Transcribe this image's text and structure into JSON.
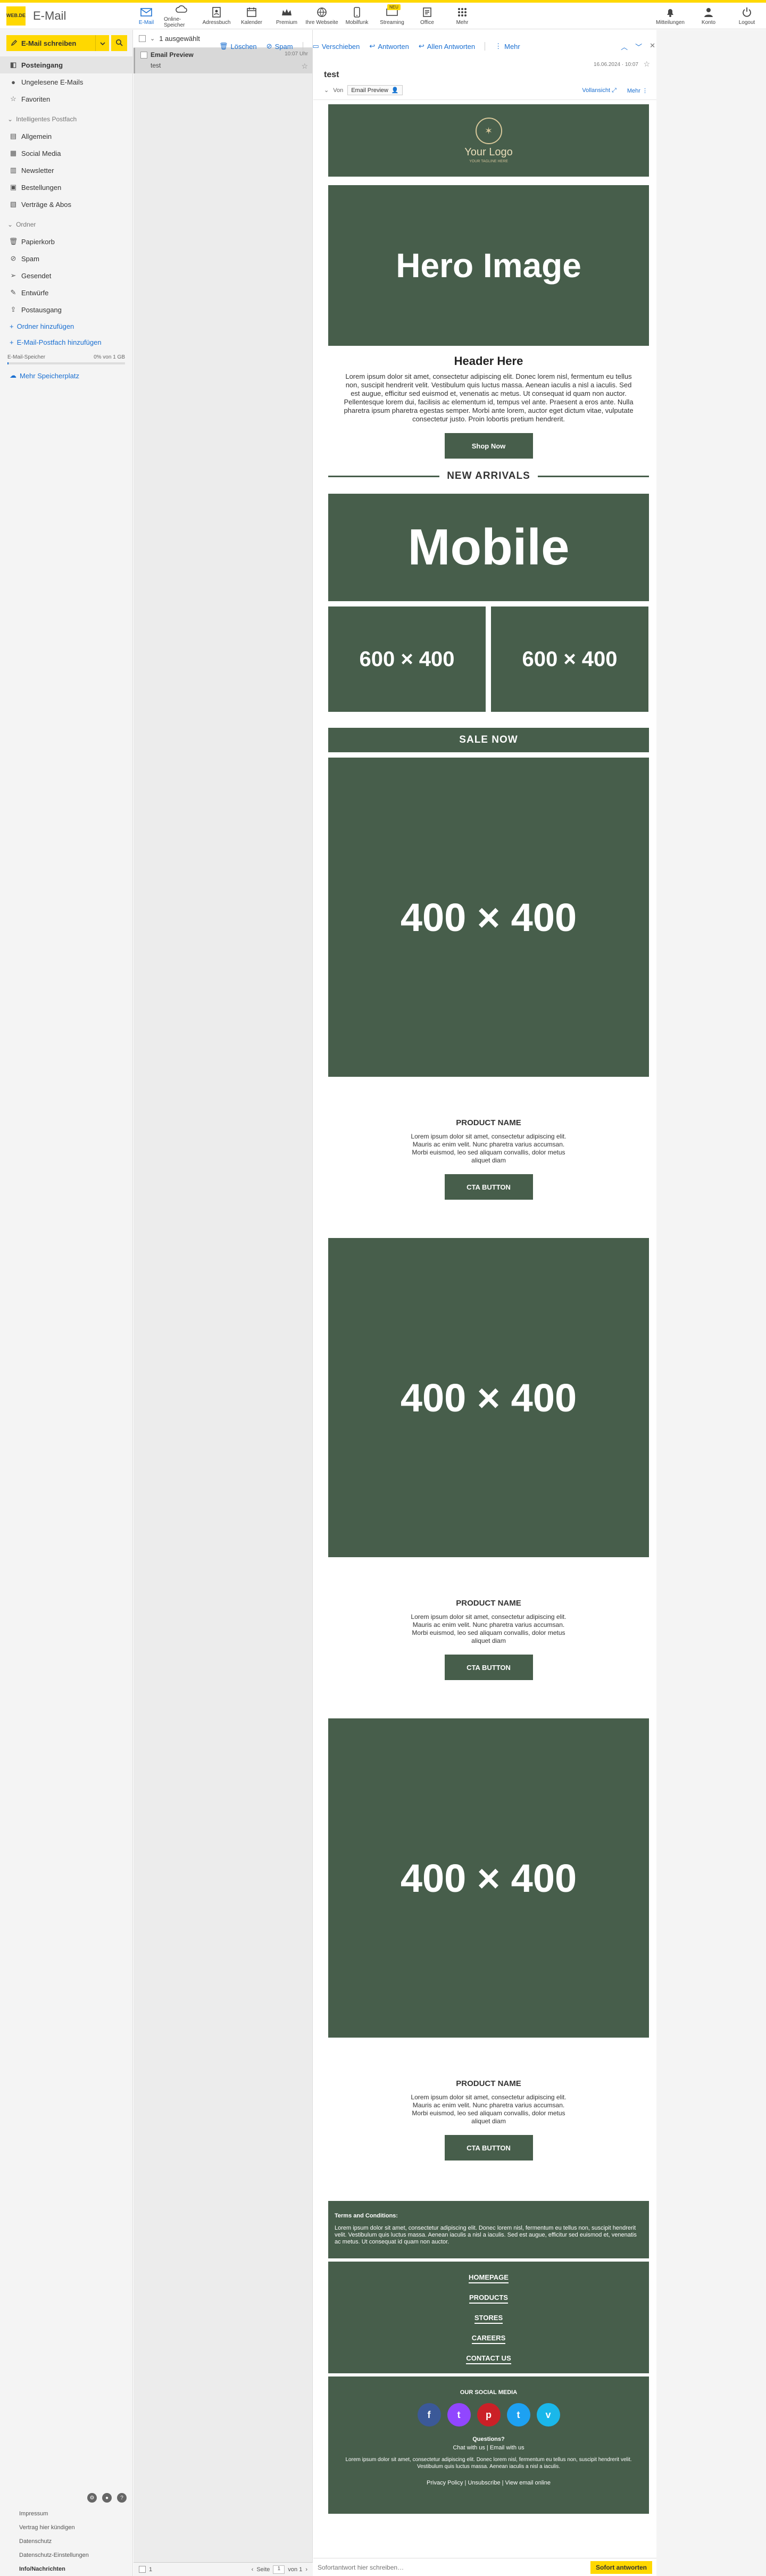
{
  "app": {
    "logo_text": "WEB.DE",
    "title": "E-Mail"
  },
  "topnav": [
    {
      "label": "E-Mail",
      "icon": "mail-icon",
      "active": true
    },
    {
      "label": "Online-Speicher",
      "icon": "cloud-icon"
    },
    {
      "label": "Adressbuch",
      "icon": "addressbook-icon"
    },
    {
      "label": "Kalender",
      "icon": "calendar-icon"
    },
    {
      "label": "Premium",
      "icon": "crown-icon"
    },
    {
      "label": "Ihre Webseite",
      "icon": "globe-icon"
    },
    {
      "label": "Mobilfunk",
      "icon": "phone-icon"
    },
    {
      "label": "Streaming",
      "icon": "tv-icon",
      "badge": "NEU"
    },
    {
      "label": "Office",
      "icon": "office-icon"
    },
    {
      "label": "Mehr",
      "icon": "grid-icon"
    }
  ],
  "topnav_right": [
    {
      "label": "Mitteilungen",
      "icon": "bell-icon"
    },
    {
      "label": "Konto",
      "icon": "user-icon"
    },
    {
      "label": "Logout",
      "icon": "power-icon"
    }
  ],
  "sidebar": {
    "compose_label": "E-Mail schreiben",
    "folders": [
      {
        "label": "Posteingang",
        "icon": "inbox-icon",
        "active": true
      },
      {
        "label": "Ungelesene E-Mails",
        "icon": "dot-icon"
      },
      {
        "label": "Favoriten",
        "icon": "star-icon"
      }
    ],
    "smart_header": "Intelligentes Postfach",
    "smart_folders": [
      {
        "label": "Allgemein",
        "icon": "general-icon"
      },
      {
        "label": "Social Media",
        "icon": "social-icon"
      },
      {
        "label": "Newsletter",
        "icon": "newsletter-icon"
      },
      {
        "label": "Bestellungen",
        "icon": "orders-icon"
      },
      {
        "label": "Verträge & Abos",
        "icon": "contracts-icon"
      }
    ],
    "folders_header": "Ordner",
    "other_folders": [
      {
        "label": "Papierkorb",
        "icon": "trash-icon"
      },
      {
        "label": "Spam",
        "icon": "spam-icon"
      },
      {
        "label": "Gesendet",
        "icon": "sent-icon"
      },
      {
        "label": "Entwürfe",
        "icon": "drafts-icon"
      },
      {
        "label": "Postausgang",
        "icon": "outbox-icon"
      }
    ],
    "add_folder": "Ordner hinzufügen",
    "add_mailbox": "E-Mail-Postfach hinzufügen",
    "storage_label": "E-Mail-Speicher",
    "storage_value": "0% von 1 GB",
    "storage_fraction": 0.01,
    "more_storage": "Mehr Speicherplatz",
    "legal": [
      "Impressum",
      "Vertrag hier kündigen",
      "Datenschutz",
      "Datenschutz-Einstellungen",
      "Info/Nachrichten"
    ]
  },
  "maillist": {
    "selected_count": "1 ausgewählt",
    "items": [
      {
        "from": "Email Preview",
        "subject": "test",
        "time": "10:07 Uhr"
      }
    ],
    "footer": {
      "page_label": "Seite",
      "page": "1",
      "of": "von 1",
      "count": "1"
    }
  },
  "toolbar": {
    "delete": "Löschen",
    "spam": "Spam",
    "move": "Verschieben",
    "reply": "Antworten",
    "reply_all": "Allen Antworten",
    "more": "Mehr"
  },
  "reader": {
    "date": "16.06.2024 · 10:07",
    "subject": "test",
    "from_label": "Von",
    "from_name": "Email Preview",
    "fullview": "Vollansicht",
    "more": "Mehr",
    "reply_placeholder": "Sofortantwort hier schreiben…",
    "reply_button": "Sofort antworten"
  },
  "email": {
    "logo_text": "Your Logo",
    "logo_sub": "YOUR TAGLINE HERE",
    "hero": "Hero Image",
    "header": "Header Here",
    "body": "Lorem ipsum dolor sit amet, consectetur adipiscing elit. Donec lorem nisl, fermentum eu tellus non, suscipit hendrerit velit. Vestibulum quis luctus massa. Aenean iaculis a nisl a iaculis. Sed est augue, efficitur sed euismod et, venenatis ac metus. Ut consequat id quam non auctor. Pellentesque lorem dui, facilisis ac elementum id, tempus vel ante. Praesent a eros ante. Nulla pharetra ipsum pharetra egestas semper. Morbi ante lorem, auctor eget dictum vitae, vulputate consectetur justo. Proin lobortis pretium hendrerit.",
    "shop_now": "Shop Now",
    "new_arrivals": "NEW ARRIVALS",
    "mobile": "Mobile",
    "thumb_a": "600 × 400",
    "thumb_b": "600 × 400",
    "sale": "SALE NOW",
    "products": [
      {
        "image": "400 × 400",
        "name": "PRODUCT NAME",
        "desc": "Lorem ipsum dolor sit amet, consectetur adipiscing elit. Mauris ac enim velit. Nunc pharetra varius accumsan. Morbi euismod, leo sed aliquam convallis, dolor metus aliquet diam",
        "cta": "CTA BUTTON"
      },
      {
        "image": "400 × 400",
        "name": "PRODUCT NAME",
        "desc": "Lorem ipsum dolor sit amet, consectetur adipiscing elit. Mauris ac enim velit. Nunc pharetra varius accumsan. Morbi euismod, leo sed aliquam convallis, dolor metus aliquet diam",
        "cta": "CTA BUTTON"
      },
      {
        "image": "400 × 400",
        "name": "PRODUCT NAME",
        "desc": "Lorem ipsum dolor sit amet, consectetur adipiscing elit. Mauris ac enim velit. Nunc pharetra varius accumsan. Morbi euismod, leo sed aliquam convallis, dolor metus aliquet diam",
        "cta": "CTA BUTTON"
      }
    ],
    "terms_title": "Terms and Conditions:",
    "terms_body": "Lorem ipsum dolor sit amet, consectetur adipiscing elit. Donec lorem nisl, fermentum eu tellus non, suscipit hendrerit velit. Vestibulum quis luctus massa. Aenean iaculis a nisl a iaculis. Sed est augue, efficitur sed euismod et, venenatis ac metus. Ut consequat id quam non auctor.",
    "footer_links": [
      "HOMEPAGE",
      "PRODUCTS",
      "STORES",
      "CAREERS",
      "CONTACT US"
    ],
    "social_title": "OUR SOCIAL MEDIA",
    "social": [
      {
        "icon": "facebook-icon",
        "glyph": "f",
        "color": "#3b5998"
      },
      {
        "icon": "twitch-icon",
        "glyph": "t",
        "color": "#9146ff"
      },
      {
        "icon": "pinterest-icon",
        "glyph": "p",
        "color": "#cb2027"
      },
      {
        "icon": "twitter-icon",
        "glyph": "t",
        "color": "#1da1f2"
      },
      {
        "icon": "vimeo-icon",
        "glyph": "v",
        "color": "#1ab7ea"
      }
    ],
    "questions": "Questions?",
    "chat": "Chat with us | Email with us",
    "small": "Lorem ipsum dolor sit amet, consectetur adipiscing elit. Donec lorem nisl, fermentum eu tellus non, suscipit hendrerit velit. Vestibulum quis luctus massa. Aenean iaculis a nisl a iaculis.",
    "policy": "Privacy Policy | Unsubscribe | View email online"
  },
  "colors": {
    "accent": "#ffd800",
    "link": "#1a6fd1",
    "email_green": "#475e4b"
  }
}
